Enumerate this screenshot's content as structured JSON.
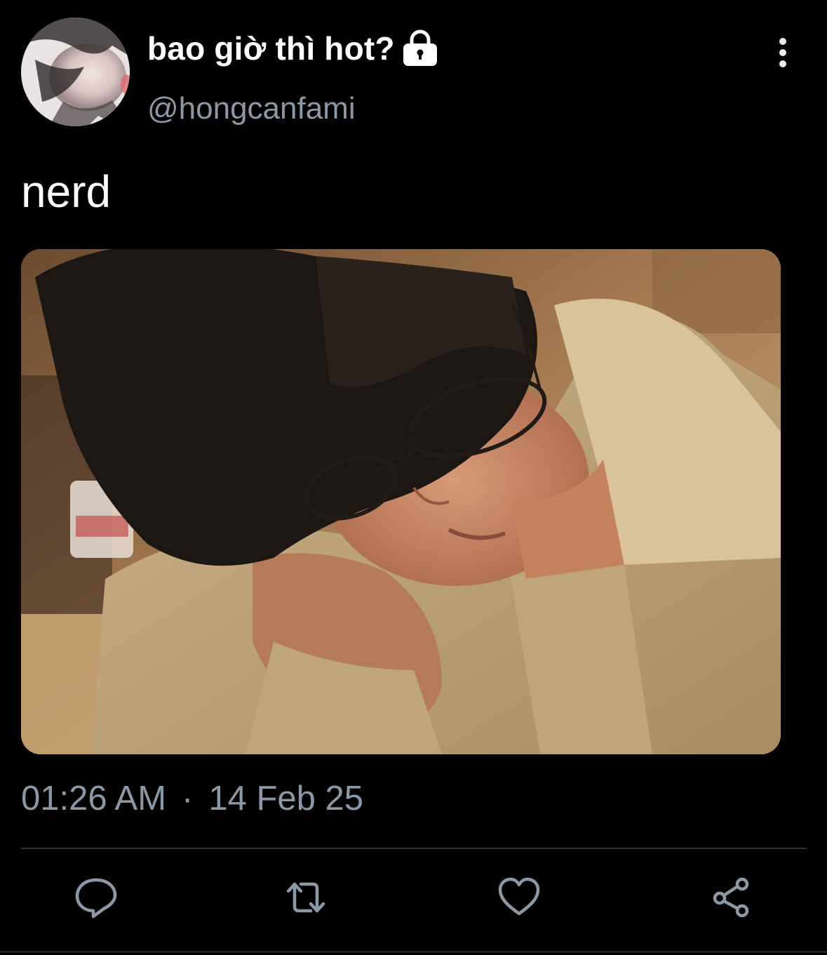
{
  "author": {
    "display_name": "bao giờ thì hot?",
    "handle": "@hongcanfami",
    "protected": true,
    "lock_icon": "lock-icon"
  },
  "tweet": {
    "text": "nerd",
    "media_description_icon": "photo",
    "time": "01:26 AM",
    "separator": "·",
    "date": "14 Feb 25"
  },
  "actions": [
    {
      "name": "reply",
      "icon": "reply-icon"
    },
    {
      "name": "retweet",
      "icon": "retweet-icon"
    },
    {
      "name": "like",
      "icon": "heart-icon"
    },
    {
      "name": "share",
      "icon": "share-icon"
    }
  ],
  "colors": {
    "background": "#000000",
    "primary_text": "#ffffff",
    "secondary_text": "#8b98a5",
    "divider": "#2f3336"
  }
}
